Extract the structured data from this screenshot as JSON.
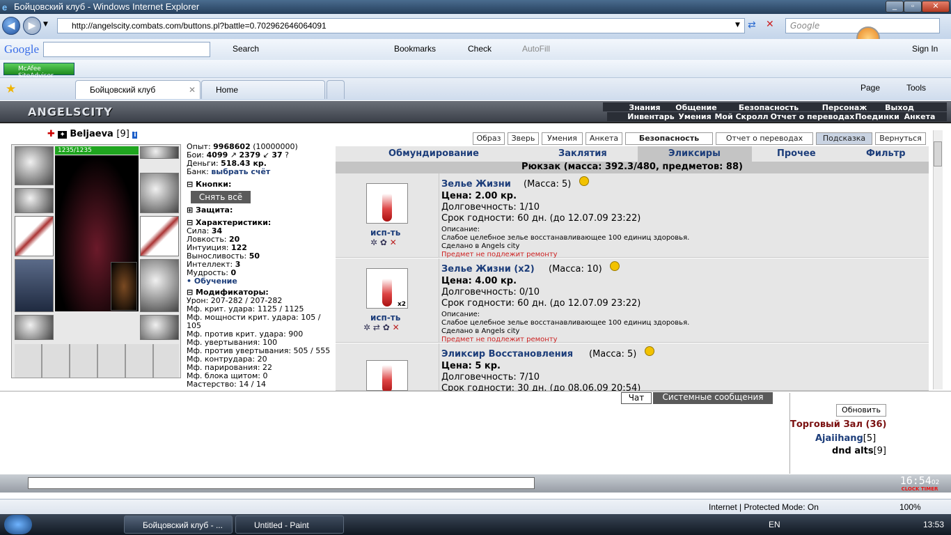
{
  "window": {
    "title": "Бойцовский клуб - Windows Internet Explorer",
    "url": "http://angelscity.combats.com/buttons.pl?battle=0.702962646064091",
    "search_placeholder": "Google"
  },
  "gtoolbar": {
    "brand": "Google",
    "search": "Search",
    "bookmarks": "Bookmarks",
    "check": "Check",
    "autofill": "AutoFill",
    "signin": "Sign In"
  },
  "mcafee": {
    "label": "McAfee SiteAdvisor"
  },
  "tabs": {
    "active": "Бойцовский клуб",
    "home": "Home",
    "page": "Page",
    "tools": "Tools"
  },
  "game": {
    "logo": "ANGELSCITY",
    "top_menu": [
      "Знания",
      "Общение",
      "Безопасность",
      "Персонаж",
      "Выход"
    ],
    "sub_menu": [
      "Инвентарь",
      "Умения",
      "Мой Скролл",
      "Отчет о переводах",
      "Поединки",
      "Анкета"
    ],
    "char": {
      "name": "Beljaeva",
      "level": "[9]",
      "hp": "1235/1235"
    },
    "stats": {
      "exp_label": "Опыт:",
      "exp": "9968602",
      "exp_next": "(10000000)",
      "fights_label": "Бои:",
      "wins": "4099",
      "losses": "2379",
      "draws": "37",
      "money_label": "Деньги:",
      "money": "518.43 кр.",
      "bank_label": "Банк:",
      "bank_link": "выбрать счёт",
      "sections": {
        "buttons": "Кнопки:",
        "remove_all": "Снять всё",
        "defense": "Защита:",
        "chars": "Характеристики:",
        "mods": "Модификаторы:"
      },
      "chars": [
        [
          "Сила:",
          "34"
        ],
        [
          "Ловкость:",
          "20"
        ],
        [
          "Интуиция:",
          "122"
        ],
        [
          "Выносливость:",
          "50"
        ],
        [
          "Интеллект:",
          "3"
        ],
        [
          "Мудрость:",
          "0"
        ]
      ],
      "training": "• Обучение",
      "mods": [
        "Урон: 207-282 / 207-282",
        "Мф. крит. удара: 1125 / 1125",
        "Мф. мощности крит. удара: 105 /",
        "105",
        "Мф. против крит. удара: 900",
        "Мф. увертывания: 100",
        "Мф. против увертывания: 505 / 555",
        "Мф. контрудара: 20",
        "Мф. парирования: 22",
        "Мф. блока щитом: 0",
        "Мастерство: 14 / 14"
      ]
    },
    "buttons": [
      "Образ",
      "Зверь",
      "Умения",
      "Анкета",
      "Безопасность",
      "Отчет о переводах",
      "Подсказка",
      "Вернуться"
    ],
    "inv_tabs": [
      "Обмундирование",
      "Заклятия",
      "Эликсиры",
      "Прочее",
      "Фильтр"
    ],
    "backpack": "Рюкзак (масса: 392.3/480, предметов: 88)",
    "items": [
      {
        "name": "Зелье Жизни",
        "mass": "(Масса: 5)",
        "price": "Цена: 2.00 кр.",
        "dur": "Долговечность: 1/10",
        "exp": "Срок годности: 60 дн. (до 12.07.09 23:22)",
        "desc_l": "Описание:",
        "desc": "Слабое целебное зелье восстанавливающее 100 единиц здоровья.",
        "made": "Сделано в Angels city",
        "repair": "Предмет не подлежит ремонту",
        "use": "исп-ть",
        "count": ""
      },
      {
        "name": "Зелье Жизни (x2)",
        "mass": "(Масса: 10)",
        "price": "Цена: 4.00 кр.",
        "dur": "Долговечность: 0/10",
        "exp": "Срок годности: 60 дн. (до 12.07.09 23:22)",
        "desc_l": "Описание:",
        "desc": "Слабое целебное зелье восстанавливающее 100 единиц здоровья.",
        "made": "Сделано в Angels city",
        "repair": "Предмет не подлежит ремонту",
        "use": "исп-ть",
        "count": "x2"
      },
      {
        "name": "Эликсир Восстановления",
        "mass": "(Масса: 5)",
        "price": "Цена: 5 кр.",
        "dur": "Долговечность: 7/10",
        "exp": "Срок годности: 30 дн. (до 08.06.09 20:54)"
      }
    ]
  },
  "chat": {
    "tab_chat": "Чат",
    "tab_sys": "Системные сообщения",
    "refresh": "Обновить",
    "room": "Торговый Зал (36)",
    "users": [
      {
        "name": "Ajaiihang",
        "lvl": "[5]"
      },
      {
        "name": "dnd alts",
        "lvl": "[9]"
      }
    ]
  },
  "clock": {
    "time": "16:54",
    "sec": "02",
    "clock_label": "CLOCK",
    "timer_label": "TIMER"
  },
  "status": {
    "zone": "Internet | Protected Mode: On",
    "zoom": "100%"
  },
  "taskbar": {
    "items": [
      "Бойцовский клуб - ...",
      "Untitled - Paint"
    ],
    "lang": "EN",
    "time": "13:53"
  },
  "colors": {
    "accent": "#1c3d7a",
    "hp": "#1fa51f",
    "repair": "#cc2222"
  }
}
